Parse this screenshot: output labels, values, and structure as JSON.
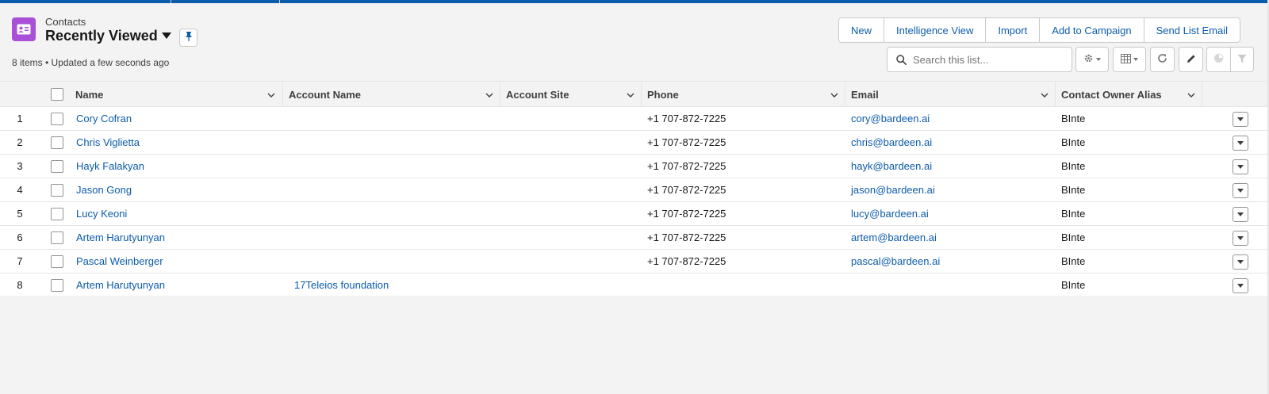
{
  "page": {
    "object_label": "Contacts",
    "list_view_title": "Recently Viewed",
    "meta_text": "8 items • Updated a few seconds ago"
  },
  "toolbar": {
    "buttons": [
      "New",
      "Intelligence View",
      "Import",
      "Add to Campaign",
      "Send List Email"
    ],
    "search_placeholder": "Search this list..."
  },
  "table": {
    "columns": [
      "Name",
      "Account Name",
      "Account Site",
      "Phone",
      "Email",
      "Contact Owner Alias"
    ],
    "rows": [
      {
        "num": "1",
        "name": "Cory Cofran",
        "account": "",
        "site": "",
        "phone": "+1 707-872-7225",
        "email": "cory@bardeen.ai",
        "owner": "BInte"
      },
      {
        "num": "2",
        "name": "Chris Viglietta",
        "account": "",
        "site": "",
        "phone": "+1 707-872-7225",
        "email": "chris@bardeen.ai",
        "owner": "BInte"
      },
      {
        "num": "3",
        "name": "Hayk Falakyan",
        "account": "",
        "site": "",
        "phone": "+1 707-872-7225",
        "email": "hayk@bardeen.ai",
        "owner": "BInte"
      },
      {
        "num": "4",
        "name": "Jason Gong",
        "account": "",
        "site": "",
        "phone": "+1 707-872-7225",
        "email": "jason@bardeen.ai",
        "owner": "BInte"
      },
      {
        "num": "5",
        "name": "Lucy Keoni",
        "account": "",
        "site": "",
        "phone": "+1 707-872-7225",
        "email": "lucy@bardeen.ai",
        "owner": "BInte"
      },
      {
        "num": "6",
        "name": "Artem Harutyunyan",
        "account": "",
        "site": "",
        "phone": "+1 707-872-7225",
        "email": "artem@bardeen.ai",
        "owner": "BInte"
      },
      {
        "num": "7",
        "name": "Pascal Weinberger",
        "account": "",
        "site": "",
        "phone": "+1 707-872-7225",
        "email": "pascal@bardeen.ai",
        "owner": "BInte"
      },
      {
        "num": "8",
        "name": "Artem Harutyunyan",
        "account": "17Teleios foundation",
        "site": "",
        "phone": "",
        "email": "",
        "owner": "BInte"
      }
    ]
  },
  "icons": {
    "object": "contact-card-icon",
    "pin": "pin-icon",
    "search": "search-icon",
    "settings": "gear-icon",
    "display": "table-display-icon",
    "refresh": "refresh-icon",
    "edit": "pencil-icon",
    "chart": "pie-chart-icon",
    "filter": "filter-icon"
  },
  "colors": {
    "accent": "#0b5cab",
    "object_icon_bg": "#a94fd8"
  }
}
